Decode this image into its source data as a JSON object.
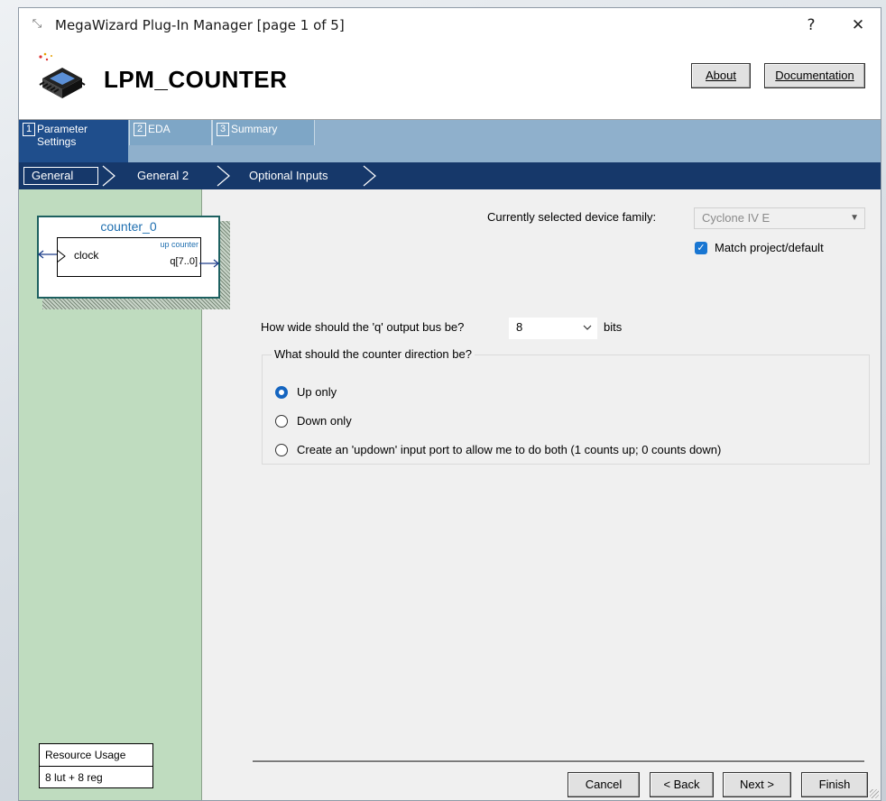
{
  "window": {
    "title": "MegaWizard Plug-In Manager [page 1 of 5]",
    "help_label": "?",
    "close_label": "✕"
  },
  "banner": {
    "title": "LPM_COUNTER",
    "about_label": "About",
    "documentation_label": "Documentation"
  },
  "tabs": [
    {
      "num": "1",
      "label": "Parameter Settings",
      "active": true
    },
    {
      "num": "2",
      "label": "EDA",
      "active": false
    },
    {
      "num": "3",
      "label": "Summary",
      "active": false
    }
  ],
  "subnav": [
    "General",
    "General 2",
    "Optional Inputs"
  ],
  "symbol": {
    "name": "counter_0",
    "input": "clock",
    "type": "up counter",
    "output": "q[7..0]"
  },
  "resource": {
    "heading": "Resource Usage",
    "value": "8 lut + 8 reg"
  },
  "device": {
    "label": "Currently selected device family:",
    "value": "Cyclone IV E",
    "match_label": "Match project/default",
    "match_checked": true
  },
  "width": {
    "question": "How wide should the 'q' output bus be?",
    "value": "8",
    "unit": "bits"
  },
  "direction": {
    "legend": "What should the counter direction be?",
    "options": [
      {
        "label": "Up only",
        "selected": true
      },
      {
        "label": "Down only",
        "selected": false
      },
      {
        "label": "Create an 'updown' input port to allow me to do both (1 counts up; 0 counts down)",
        "selected": false
      }
    ]
  },
  "buttons": {
    "cancel": "Cancel",
    "back": "< Back",
    "next": "Next >",
    "finish": "Finish"
  },
  "colors": {
    "tab_active": "#1f4e8c",
    "subnav": "#16386a",
    "left_pane": "#bfdcbf",
    "accent": "#1976d2"
  }
}
